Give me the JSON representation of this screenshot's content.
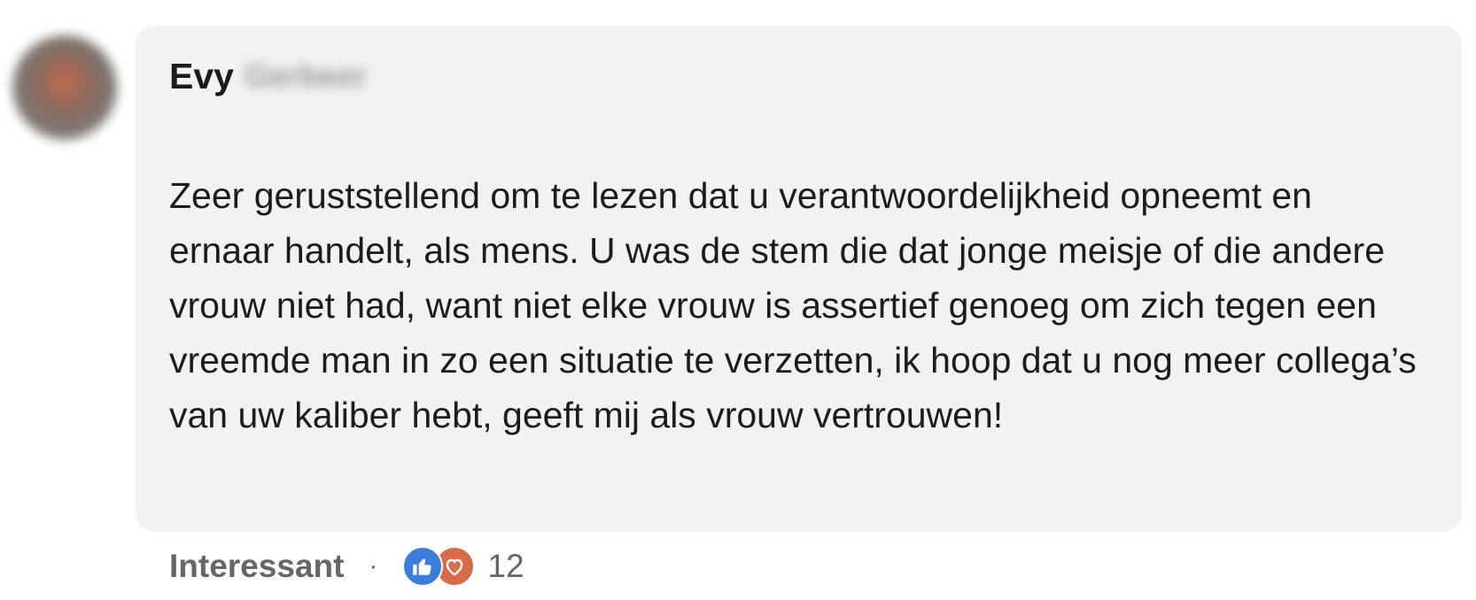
{
  "comment": {
    "author": {
      "first_name": "Evy",
      "last_name_blurred": "Gerbeer"
    },
    "text": "Zeer geruststellend om te lezen dat u verantwoordelijkheid opneemt en ernaar handelt, als mens. U was de stem die dat jonge meisje of die andere vrouw niet had, want niet elke vrouw is assertief genoeg om zich tegen een vreemde man in zo een situatie te verzetten, ik hoop dat u nog meer collega’s van uw kaliber hebt, geeft mij als vrouw vertrouwen!",
    "actions": {
      "reaction_label": "Interessant",
      "separator": "·"
    },
    "reactions": {
      "icons": [
        "thumbs-up-icon",
        "heart-icon"
      ],
      "count": "12"
    }
  },
  "colors": {
    "bubble": "#f2f2f2",
    "like": "#3b7ddb",
    "love": "#d86b4a",
    "muted_text": "#666666"
  }
}
